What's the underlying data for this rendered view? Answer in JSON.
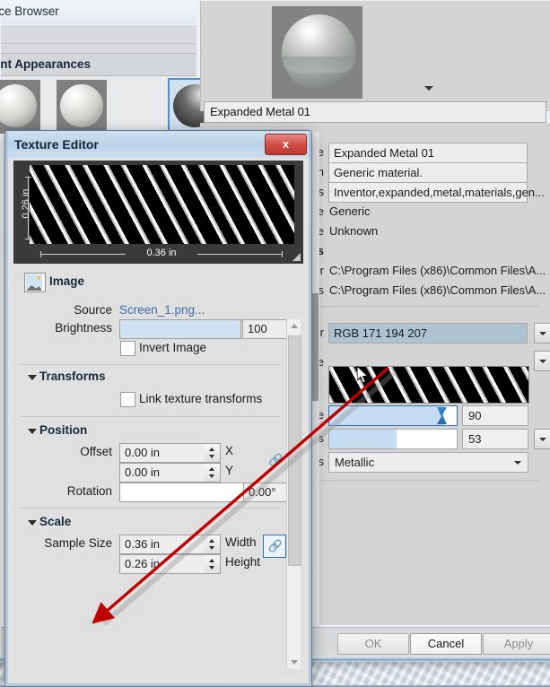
{
  "app": {
    "browser": {
      "title": "...ce Browser",
      "category": "...nt Appearances",
      "thumbnails": [
        "appearance-thumb-1",
        "appearance-thumb-2",
        "appearance-thumb-3"
      ]
    },
    "preview": {
      "sphere_label": "material-preview-sphere",
      "name_value": "Expanded Metal 01",
      "caret": "dropdown-caret"
    },
    "properties": [
      {
        "label": "...e",
        "kind": "input",
        "value": "Expanded Metal 01"
      },
      {
        "label": "...n",
        "kind": "input",
        "value": "Generic material."
      },
      {
        "label": "...ds",
        "kind": "input",
        "value": "Inventor,expanded,metal,materials,gen..."
      },
      {
        "label": "...e",
        "kind": "text",
        "value": "Generic"
      },
      {
        "label": "...te",
        "kind": "text",
        "value": "Unknown"
      },
      {
        "label": "...ns",
        "kind": "header",
        "value": ""
      },
      {
        "label": "...or",
        "kind": "text",
        "value": "C:\\Program Files (x86)\\Common Files\\A..."
      },
      {
        "label": "...ts",
        "kind": "text",
        "value": "C:\\Program Files (x86)\\Common Files\\A..."
      }
    ],
    "generic": {
      "color_label": "...or",
      "color_value": "RGB 171 194 207",
      "image_label": "...je",
      "image_file": "Screen_1.png",
      "scale_label": "...le",
      "scale_value": "90",
      "gloss_label": "...ss",
      "gloss_value": "53",
      "highlights_label": "...ts",
      "highlights_value": "Metallic"
    },
    "buttons": {
      "ok": "OK",
      "cancel": "Cancel",
      "apply": "Apply"
    }
  },
  "texture_editor": {
    "title": "Texture Editor",
    "close": "x",
    "preview": {
      "height_label": "0.26 in",
      "width_label": "0.36 in"
    },
    "image_section": {
      "heading": "Image",
      "source_label": "Source",
      "source_value": "Screen_1.png...",
      "brightness_label": "Brightness",
      "brightness_value": "100",
      "invert_label": "Invert Image"
    },
    "transforms_section": {
      "heading": "Transforms",
      "link_label": "Link texture transforms"
    },
    "position_section": {
      "heading": "Position",
      "offset_label": "Offset",
      "offset_x_value": "0.00 in",
      "offset_x_axis": "X",
      "offset_y_value": "0.00 in",
      "offset_y_axis": "Y",
      "rotation_label": "Rotation",
      "rotation_value": "0.00°"
    },
    "scale_section": {
      "heading": "Scale",
      "sample_size_label": "Sample Size",
      "width_value": "0.36 in",
      "width_axis": "Width",
      "height_value": "0.26 in",
      "height_axis": "Height"
    }
  },
  "colors": {
    "accent": "#2e74b5",
    "title_bar": "#b7d1e9",
    "close_red": "#cf4a43",
    "annotation_red": "#c00000",
    "color_swatch": "#adc3d1",
    "slider_fill": "#c5dcf2"
  }
}
